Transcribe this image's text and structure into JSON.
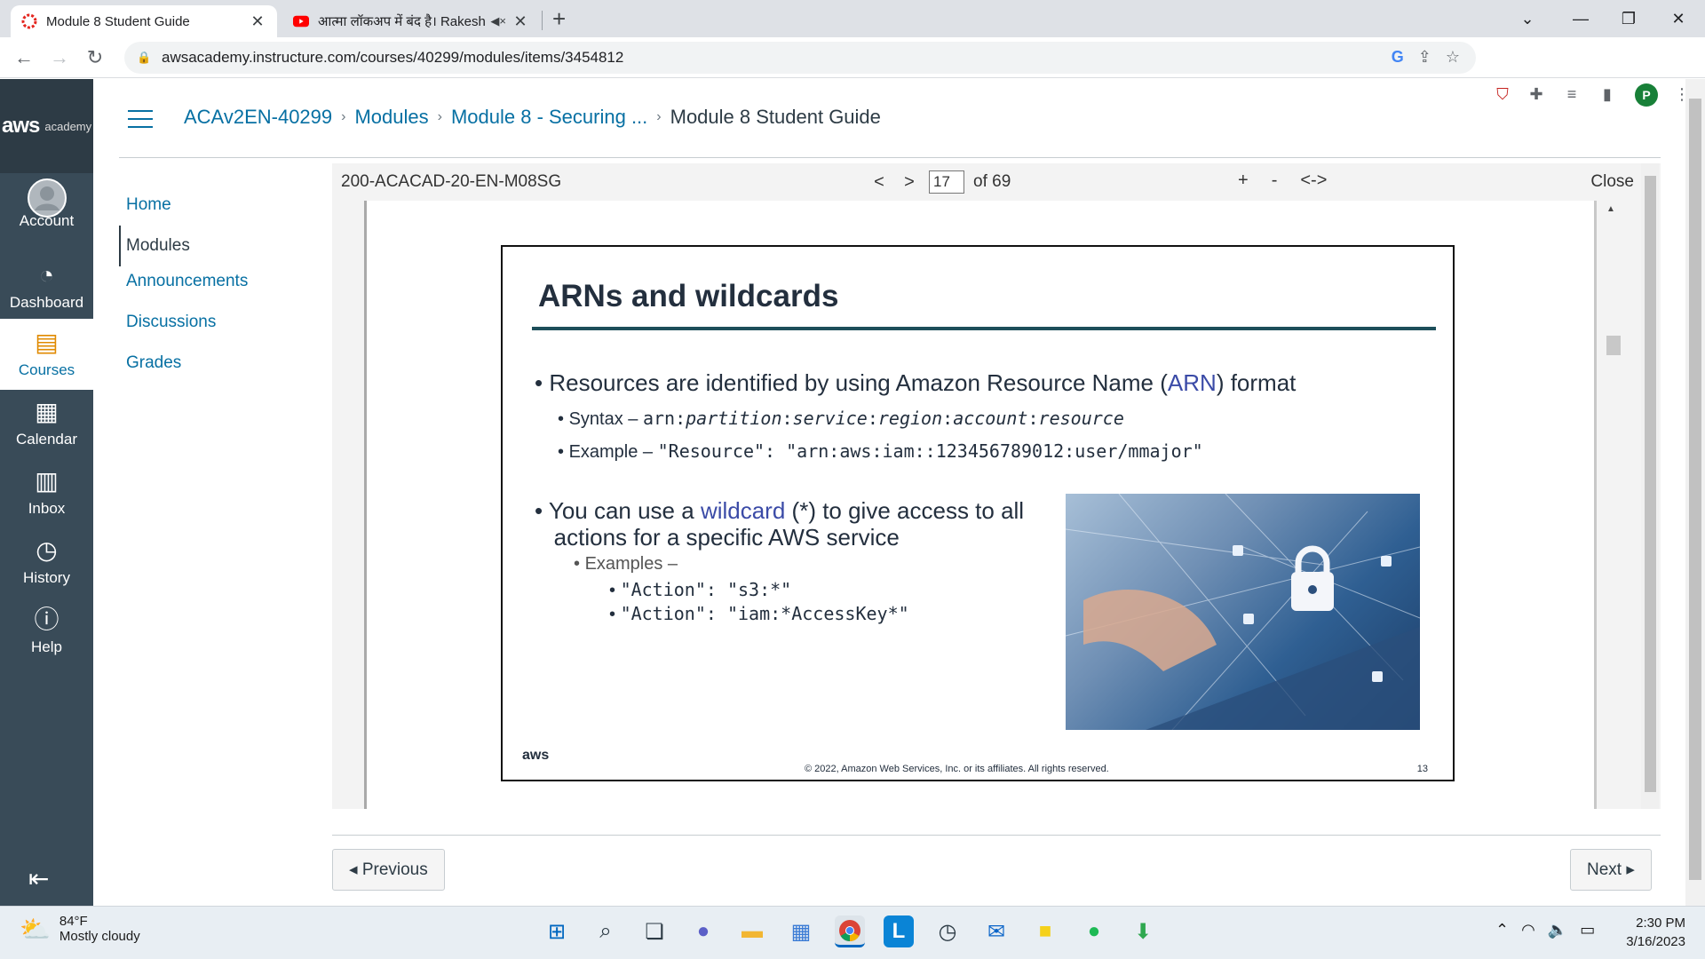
{
  "browser": {
    "tabs": [
      {
        "title": "Module 8 Student Guide",
        "active": true
      },
      {
        "title": "आत्मा लॉकअप में बंद है। Rakesh",
        "active": false
      }
    ],
    "url": "awsacademy.instructure.com/courses/40299/modules/items/3454812",
    "profile_initial": "P"
  },
  "global_nav": {
    "logo_main": "aws",
    "logo_sub": "academy",
    "items": [
      {
        "label": "Account",
        "icon": "account-icon"
      },
      {
        "label": "Dashboard",
        "icon": "dashboard-icon"
      },
      {
        "label": "Courses",
        "icon": "courses-icon"
      },
      {
        "label": "Calendar",
        "icon": "calendar-icon"
      },
      {
        "label": "Inbox",
        "icon": "inbox-icon"
      },
      {
        "label": "History",
        "icon": "history-icon"
      },
      {
        "label": "Help",
        "icon": "help-icon"
      }
    ]
  },
  "breadcrumb": {
    "items": [
      "ACAv2EN-40299",
      "Modules",
      "Module 8 - Securing ...",
      "Module 8 Student Guide"
    ]
  },
  "course_nav": {
    "items": [
      "Home",
      "Modules",
      "Announcements",
      "Discussions",
      "Grades"
    ],
    "active": "Modules"
  },
  "viewer": {
    "doc_name": "200-ACACAD-20-EN-M08SG",
    "prev": "<",
    "next": ">",
    "page": "17",
    "of_pages": "of 69",
    "zoom_in": "+",
    "zoom_out": "-",
    "fit": "<->",
    "close": "Close"
  },
  "slide": {
    "title": "ARNs and wildcards",
    "bullet1_pre": "Resources are identified by using Amazon Resource Name (",
    "bullet1_hl": "ARN",
    "bullet1_post": ") format",
    "syntax_label": "Syntax –",
    "syntax_arn": "arn:",
    "syntax_partition": "partition",
    "syntax_service": "service",
    "syntax_region": "region",
    "syntax_account": "account",
    "syntax_resource": "resource",
    "example_label": "Example –",
    "example_code": "\"Resource\":  \"arn:aws:iam::123456789012:user/mmajor\"",
    "bullet2_pre": "You can use a ",
    "bullet2_hl": "wildcard",
    "bullet2_post1": " (*) to give access to all",
    "bullet2_post2": "actions for a specific AWS service",
    "examples_label": "Examples –",
    "example_a": "\"Action\":  \"s3:*\"",
    "example_b": "\"Action\":  \"iam:*AccessKey*\"",
    "footer_logo": "aws",
    "copyright": "© 2022, Amazon Web Services, Inc. or its affiliates. All rights reserved.",
    "page_number": "13"
  },
  "pager": {
    "previous": "◂ Previous",
    "next": "Next ▸"
  },
  "taskbar": {
    "temp": "84°F",
    "weather": "Mostly cloudy",
    "time": "2:30 PM",
    "date": "3/16/2023"
  }
}
